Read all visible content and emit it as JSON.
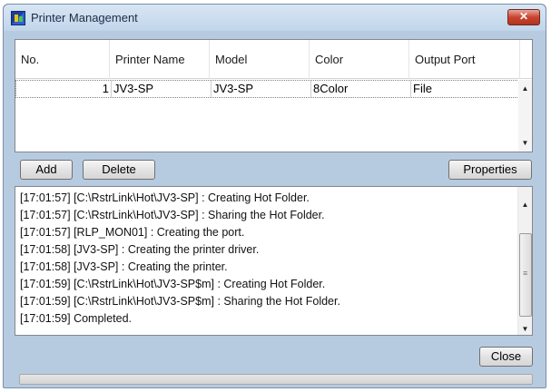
{
  "window": {
    "title": "Printer Management",
    "close_glyph": "✕"
  },
  "printer_list": {
    "columns": [
      "No.",
      "Printer Name",
      "Model",
      "Color",
      "Output Port"
    ],
    "rows": [
      {
        "no": "1",
        "printer_name": "JV3-SP",
        "model": "JV3-SP",
        "color": "8Color",
        "output_port": "File"
      }
    ]
  },
  "buttons": {
    "add": "Add",
    "delete": "Delete",
    "properties": "Properties",
    "close": "Close"
  },
  "log": {
    "lines": [
      "[17:01:57] [C:\\RstrLink\\Hot\\JV3-SP] : Creating Hot Folder.",
      "[17:01:57] [C:\\RstrLink\\Hot\\JV3-SP] : Sharing the Hot Folder.",
      "[17:01:57] [RLP_MON01] : Creating the port.",
      "[17:01:58] [JV3-SP] : Creating the printer driver.",
      "[17:01:58] [JV3-SP] : Creating the printer.",
      "[17:01:59] [C:\\RstrLink\\Hot\\JV3-SP$m] : Creating Hot Folder.",
      "[17:01:59] [C:\\RstrLink\\Hot\\JV3-SP$m] : Sharing the Hot Folder.",
      "[17:01:59] Completed."
    ]
  },
  "icons": {
    "scroll_up": "▲",
    "scroll_down": "▼",
    "grip": "≡"
  }
}
